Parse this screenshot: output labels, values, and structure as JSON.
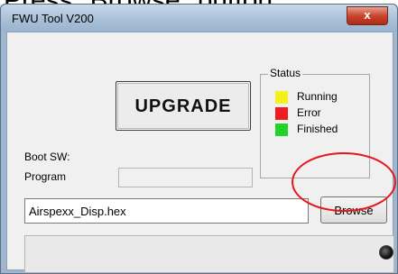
{
  "caption": "Press \"Browse\" button",
  "window": {
    "title": "FWU Tool V200",
    "close_label": "x"
  },
  "upgrade_button": {
    "label": "UPGRADE"
  },
  "status": {
    "title": "Status",
    "items": [
      {
        "label": "Running",
        "color": "#f3f01b"
      },
      {
        "label": "Error",
        "color": "#ee1c1c"
      },
      {
        "label": "Finished",
        "color": "#22d42a"
      }
    ]
  },
  "fields": {
    "boot_sw_label": "Boot SW:",
    "program_label": "Program",
    "program_value": ""
  },
  "file": {
    "value": "Airspexx_Disp.hex",
    "browse_label": "Browse"
  },
  "colors": {
    "highlight": "#e8151c",
    "indicator": "#000000"
  }
}
